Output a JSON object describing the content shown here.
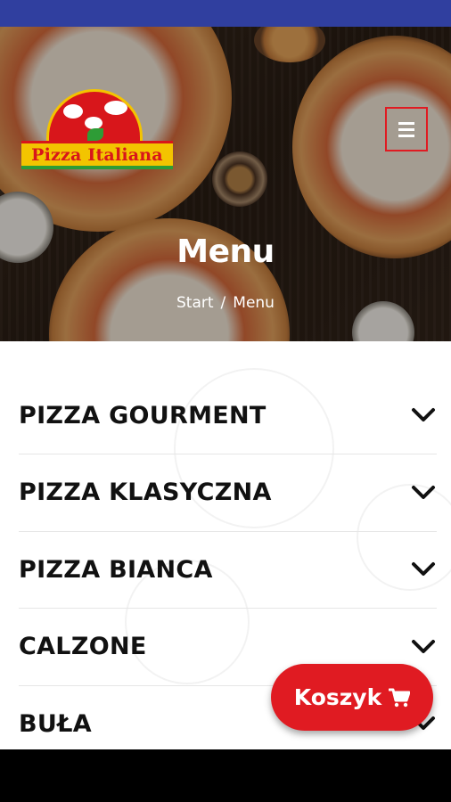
{
  "header": {
    "logo_text": "Pizza Italiana",
    "menu_icon": "hamburger-icon"
  },
  "hero": {
    "title": "Menu",
    "breadcrumb": {
      "home": "Start",
      "separator": "/",
      "current": "Menu"
    }
  },
  "categories": [
    {
      "label": "PIZZA GOURMENT",
      "icon": "chevron-down-icon"
    },
    {
      "label": "PIZZA KLASYCZNA",
      "icon": "chevron-down-icon"
    },
    {
      "label": "PIZZA BIANCA",
      "icon": "chevron-down-icon"
    },
    {
      "label": "CALZONE",
      "icon": "chevron-down-icon"
    },
    {
      "label": "BUŁA",
      "icon": "chevron-down-icon"
    }
  ],
  "cart": {
    "label": "Koszyk",
    "icon": "cart-icon"
  },
  "colors": {
    "status_bar": "#303f9f",
    "accent_red": "#e01b22",
    "logo_yellow": "#f3c400",
    "logo_green": "#2e9c36",
    "text_dark": "#111111"
  }
}
